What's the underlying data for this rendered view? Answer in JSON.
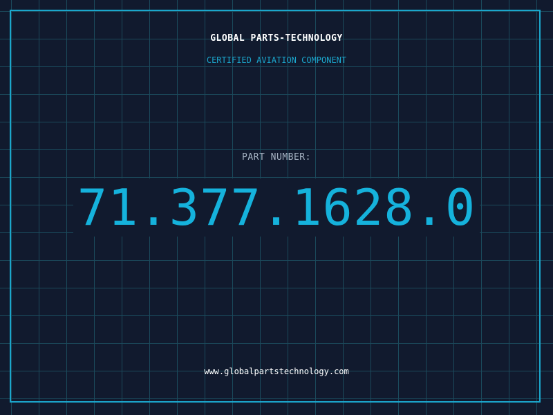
{
  "header": {
    "company": "GLOBAL PARTS-TECHNOLOGY",
    "subtitle": "CERTIFIED AVIATION COMPONENT"
  },
  "part": {
    "label": "PART NUMBER:",
    "number": "71.377.1628.0"
  },
  "footer": {
    "website": "www.globalpartstechnology.com"
  },
  "colors": {
    "background": "#111a2e",
    "grid": "#1b4a5c",
    "accent": "#1ba6cc",
    "part_number": "#15b2dc",
    "text": "#ffffff"
  }
}
